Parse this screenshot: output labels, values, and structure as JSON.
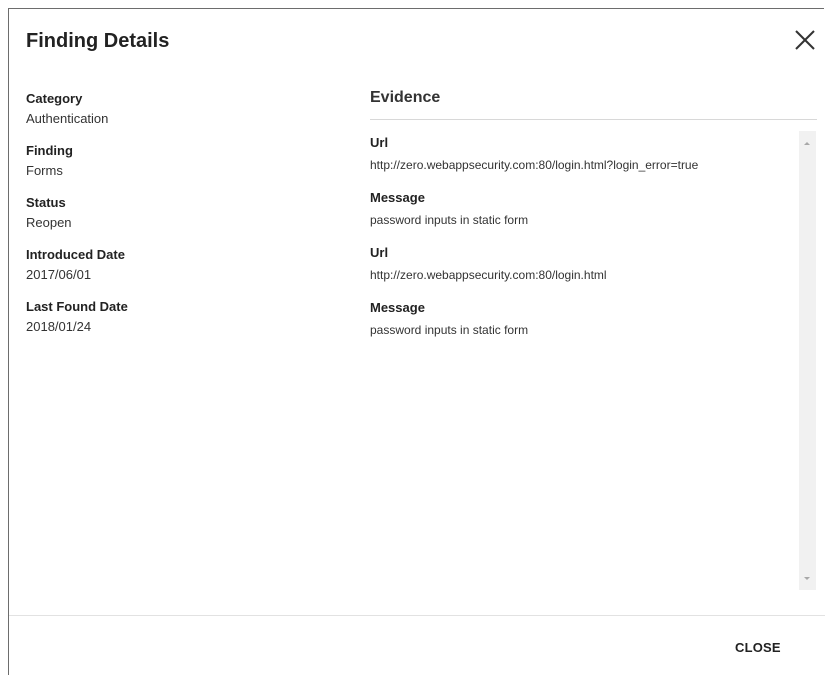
{
  "dialog": {
    "title": "Finding Details",
    "close_icon": "close-icon",
    "close_button_label": "CLOSE"
  },
  "details": [
    {
      "label": "Category",
      "value": "Authentication"
    },
    {
      "label": "Finding",
      "value": "Forms"
    },
    {
      "label": "Status",
      "value": "Reopen"
    },
    {
      "label": "Introduced Date",
      "value": "2017/06/01"
    },
    {
      "label": "Last Found Date",
      "value": "2018/01/24"
    }
  ],
  "evidence": {
    "title": "Evidence",
    "items": [
      {
        "label": "Url",
        "value": "http://zero.webappsecurity.com:80/login.html?login_error=true"
      },
      {
        "label": "Message",
        "value": "password inputs in static form"
      },
      {
        "label": "Url",
        "value": "http://zero.webappsecurity.com:80/login.html"
      },
      {
        "label": "Message",
        "value": "password inputs in static form"
      }
    ]
  }
}
